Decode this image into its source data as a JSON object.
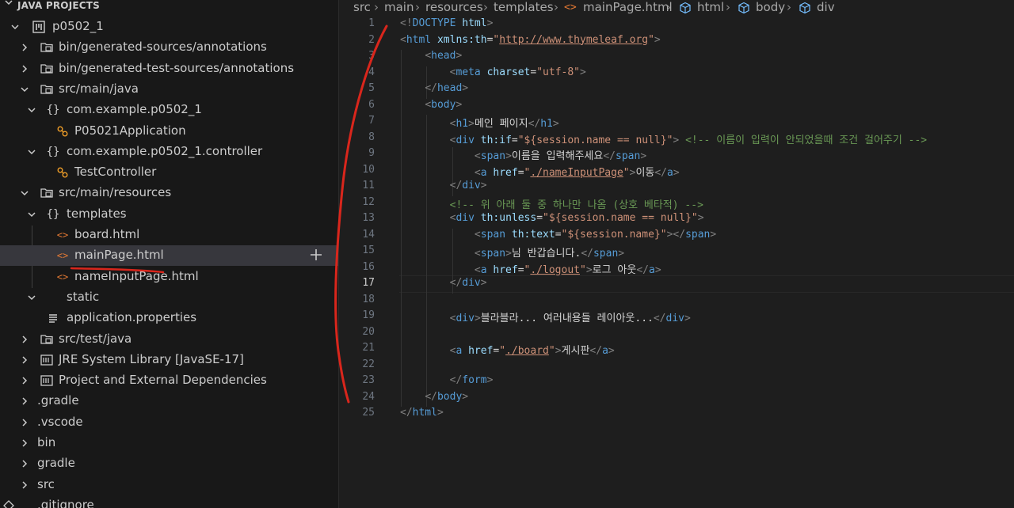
{
  "explorer": {
    "section_title": "JAVA PROJECTS",
    "items": [
      {
        "label": "p0502_1",
        "icon": "project-icon",
        "chev": "down",
        "depth": 0
      },
      {
        "label": "bin/generated-sources/annotations",
        "icon": "package-folder-icon",
        "chev": "right",
        "depth": 1
      },
      {
        "label": "bin/generated-test-sources/annotations",
        "icon": "package-folder-icon",
        "chev": "right",
        "depth": 1
      },
      {
        "label": "src/main/java",
        "icon": "package-folder-icon",
        "chev": "down",
        "depth": 1
      },
      {
        "label": "com.example.p0502_1",
        "icon": "braces-icon",
        "chev": "down",
        "depth": 2
      },
      {
        "label": "P05021Application",
        "icon": "java-class-icon",
        "chev": "none",
        "depth": 3
      },
      {
        "label": "com.example.p0502_1.controller",
        "icon": "braces-icon",
        "chev": "down",
        "depth": 2
      },
      {
        "label": "TestController",
        "icon": "java-class-icon",
        "chev": "none",
        "depth": 3
      },
      {
        "label": "src/main/resources",
        "icon": "package-folder-icon",
        "chev": "down",
        "depth": 1
      },
      {
        "label": "templates",
        "icon": "braces-icon",
        "chev": "down",
        "depth": 2
      },
      {
        "label": "board.html",
        "icon": "html-file-icon",
        "chev": "none",
        "depth": 3
      },
      {
        "label": "mainPage.html",
        "icon": "html-file-icon",
        "chev": "none",
        "depth": 3,
        "selected": true
      },
      {
        "label": "nameInputPage.html",
        "icon": "html-file-icon",
        "chev": "none",
        "depth": 3
      },
      {
        "label": "static",
        "icon": "none",
        "chev": "down",
        "depth": 2
      },
      {
        "label": "application.properties",
        "icon": "properties-file-icon",
        "chev": "none",
        "depth": 2
      },
      {
        "label": "src/test/java",
        "icon": "package-folder-icon",
        "chev": "right",
        "depth": 1
      },
      {
        "label": "JRE System Library [JavaSE-17]",
        "icon": "library-icon",
        "chev": "right",
        "depth": 1
      },
      {
        "label": "Project and External Dependencies",
        "icon": "library-icon",
        "chev": "right",
        "depth": 1
      },
      {
        "label": ".gradle",
        "icon": "none",
        "chev": "right",
        "depth": 0.5
      },
      {
        "label": ".vscode",
        "icon": "none",
        "chev": "right",
        "depth": 0.5
      },
      {
        "label": "bin",
        "icon": "none",
        "chev": "right",
        "depth": 0.5
      },
      {
        "label": "gradle",
        "icon": "none",
        "chev": "right",
        "depth": 0.5
      },
      {
        "label": "src",
        "icon": "none",
        "chev": "right",
        "depth": 0.5
      },
      {
        "label": ".gitignore",
        "icon": "git-file-icon",
        "chev": "none",
        "depth": 0.5
      }
    ]
  },
  "breadcrumb": {
    "segments": [
      "src",
      "main",
      "resources",
      "templates",
      "mainPage.html",
      "html",
      "body",
      "div"
    ]
  },
  "editor": {
    "active_line": 17,
    "lines": [
      [
        [
          "t-punc",
          "<!"
        ],
        [
          "t-tag",
          "DOCTYPE"
        ],
        [
          "t-text",
          " "
        ],
        [
          "t-attr",
          "html"
        ],
        [
          "t-punc",
          ">"
        ]
      ],
      [
        [
          "t-punc",
          "<"
        ],
        [
          "t-tag",
          "html"
        ],
        [
          "t-text",
          " "
        ],
        [
          "t-attr",
          "xmlns:th"
        ],
        [
          "t-text",
          "="
        ],
        [
          "t-str",
          "\""
        ],
        [
          "t-link",
          "http://www.thymeleaf.org"
        ],
        [
          "t-str",
          "\""
        ],
        [
          "t-punc",
          ">"
        ]
      ],
      [
        [
          "t-text",
          "    "
        ],
        [
          "t-punc",
          "<"
        ],
        [
          "t-tag",
          "head"
        ],
        [
          "t-punc",
          ">"
        ]
      ],
      [
        [
          "t-text",
          "        "
        ],
        [
          "t-punc",
          "<"
        ],
        [
          "t-tag",
          "meta"
        ],
        [
          "t-text",
          " "
        ],
        [
          "t-attr",
          "charset"
        ],
        [
          "t-text",
          "="
        ],
        [
          "t-str",
          "\"utf-8\""
        ],
        [
          "t-punc",
          ">"
        ]
      ],
      [
        [
          "t-text",
          "    "
        ],
        [
          "t-punc",
          "</"
        ],
        [
          "t-tag",
          "head"
        ],
        [
          "t-punc",
          ">"
        ]
      ],
      [
        [
          "t-text",
          "    "
        ],
        [
          "t-punc",
          "<"
        ],
        [
          "t-tag",
          "body"
        ],
        [
          "t-punc",
          ">"
        ]
      ],
      [
        [
          "t-text",
          "        "
        ],
        [
          "t-punc",
          "<"
        ],
        [
          "t-tag",
          "h1"
        ],
        [
          "t-punc",
          ">"
        ],
        [
          "t-text",
          "메인 페이지"
        ],
        [
          "t-punc",
          "</"
        ],
        [
          "t-tag",
          "h1"
        ],
        [
          "t-punc",
          ">"
        ]
      ],
      [
        [
          "t-text",
          "        "
        ],
        [
          "t-punc",
          "<"
        ],
        [
          "t-tag",
          "div"
        ],
        [
          "t-text",
          " "
        ],
        [
          "t-attr",
          "th:if"
        ],
        [
          "t-text",
          "="
        ],
        [
          "t-str",
          "\"${session.name == null}\""
        ],
        [
          "t-punc",
          ">"
        ],
        [
          "t-text",
          " "
        ],
        [
          "t-cmt",
          "<!-- 이름이 입력이 안되었을때 조건 걸어주기 -->"
        ]
      ],
      [
        [
          "t-text",
          "            "
        ],
        [
          "t-punc",
          "<"
        ],
        [
          "t-tag",
          "span"
        ],
        [
          "t-punc",
          ">"
        ],
        [
          "t-text",
          "이름을 입력해주세요"
        ],
        [
          "t-punc",
          "</"
        ],
        [
          "t-tag",
          "span"
        ],
        [
          "t-punc",
          ">"
        ]
      ],
      [
        [
          "t-text",
          "            "
        ],
        [
          "t-punc",
          "<"
        ],
        [
          "t-tag",
          "a"
        ],
        [
          "t-text",
          " "
        ],
        [
          "t-attr",
          "href"
        ],
        [
          "t-text",
          "="
        ],
        [
          "t-str",
          "\""
        ],
        [
          "t-link",
          "./nameInputPage"
        ],
        [
          "t-str",
          "\""
        ],
        [
          "t-punc",
          ">"
        ],
        [
          "t-text",
          "이동"
        ],
        [
          "t-punc",
          "</"
        ],
        [
          "t-tag",
          "a"
        ],
        [
          "t-punc",
          ">"
        ]
      ],
      [
        [
          "t-text",
          "        "
        ],
        [
          "t-punc",
          "</"
        ],
        [
          "t-tag",
          "div"
        ],
        [
          "t-punc",
          ">"
        ]
      ],
      [
        [
          "t-text",
          "        "
        ],
        [
          "t-cmt",
          "<!-- 위 아래 둘 중 하나만 나옴 (상호 베타적) -->"
        ]
      ],
      [
        [
          "t-text",
          "        "
        ],
        [
          "t-punc",
          "<"
        ],
        [
          "t-tag",
          "div"
        ],
        [
          "t-text",
          " "
        ],
        [
          "t-attr",
          "th:unless"
        ],
        [
          "t-text",
          "="
        ],
        [
          "t-str",
          "\"${session.name == null}\""
        ],
        [
          "t-punc",
          ">"
        ]
      ],
      [
        [
          "t-text",
          "            "
        ],
        [
          "t-punc",
          "<"
        ],
        [
          "t-tag",
          "span"
        ],
        [
          "t-text",
          " "
        ],
        [
          "t-attr",
          "th:text"
        ],
        [
          "t-text",
          "="
        ],
        [
          "t-str",
          "\"${session.name}\""
        ],
        [
          "t-punc",
          "></"
        ],
        [
          "t-tag",
          "span"
        ],
        [
          "t-punc",
          ">"
        ]
      ],
      [
        [
          "t-text",
          "            "
        ],
        [
          "t-punc",
          "<"
        ],
        [
          "t-tag",
          "span"
        ],
        [
          "t-punc",
          ">"
        ],
        [
          "t-text",
          "님 반갑습니다."
        ],
        [
          "t-punc",
          "</"
        ],
        [
          "t-tag",
          "span"
        ],
        [
          "t-punc",
          ">"
        ]
      ],
      [
        [
          "t-text",
          "            "
        ],
        [
          "t-punc",
          "<"
        ],
        [
          "t-tag",
          "a"
        ],
        [
          "t-text",
          " "
        ],
        [
          "t-attr",
          "href"
        ],
        [
          "t-text",
          "="
        ],
        [
          "t-str",
          "\""
        ],
        [
          "t-link",
          "./logout"
        ],
        [
          "t-str",
          "\""
        ],
        [
          "t-punc",
          ">"
        ],
        [
          "t-text",
          "로그 아웃"
        ],
        [
          "t-punc",
          "</"
        ],
        [
          "t-tag",
          "a"
        ],
        [
          "t-punc",
          ">"
        ]
      ],
      [
        [
          "t-text",
          "        "
        ],
        [
          "t-punc",
          "</"
        ],
        [
          "t-tag",
          "div"
        ],
        [
          "t-punc",
          ">"
        ]
      ],
      [],
      [
        [
          "t-text",
          "        "
        ],
        [
          "t-punc",
          "<"
        ],
        [
          "t-tag",
          "div"
        ],
        [
          "t-punc",
          ">"
        ],
        [
          "t-text",
          "블라블라... 여러내용들 레이아웃..."
        ],
        [
          "t-punc",
          "</"
        ],
        [
          "t-tag",
          "div"
        ],
        [
          "t-punc",
          ">"
        ]
      ],
      [],
      [
        [
          "t-text",
          "        "
        ],
        [
          "t-punc",
          "<"
        ],
        [
          "t-tag",
          "a"
        ],
        [
          "t-text",
          " "
        ],
        [
          "t-attr",
          "href"
        ],
        [
          "t-text",
          "="
        ],
        [
          "t-str",
          "\""
        ],
        [
          "t-link",
          "./board"
        ],
        [
          "t-str",
          "\""
        ],
        [
          "t-punc",
          ">"
        ],
        [
          "t-text",
          "게시판"
        ],
        [
          "t-punc",
          "</"
        ],
        [
          "t-tag",
          "a"
        ],
        [
          "t-punc",
          ">"
        ]
      ],
      [],
      [
        [
          "t-text",
          "        "
        ],
        [
          "t-punc",
          "</"
        ],
        [
          "t-tag",
          "form"
        ],
        [
          "t-punc",
          ">"
        ]
      ],
      [
        [
          "t-text",
          "    "
        ],
        [
          "t-punc",
          "</"
        ],
        [
          "t-tag",
          "body"
        ],
        [
          "t-punc",
          ">"
        ]
      ],
      [
        [
          "t-punc",
          "</"
        ],
        [
          "t-tag",
          "html"
        ],
        [
          "t-punc",
          ">"
        ]
      ]
    ]
  },
  "colors": {
    "annotation": "#d9261c",
    "tag": "#569cd6",
    "attribute": "#9cdcfe",
    "string": "#ce9178",
    "comment": "#6a9955"
  }
}
